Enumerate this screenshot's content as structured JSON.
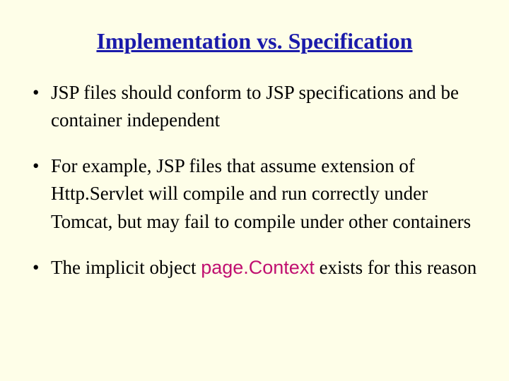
{
  "title": "Implementation vs. Specification",
  "bullets": {
    "b1": "JSP files should conform to JSP specifications and be container independent",
    "b2": "For example, JSP files that assume extension of Http.Servlet will compile and run correctly under Tomcat, but may fail to compile under other containers",
    "b3_pre": "The implicit object ",
    "b3_term": "page.Context",
    "b3_post": " exists for this reason"
  }
}
